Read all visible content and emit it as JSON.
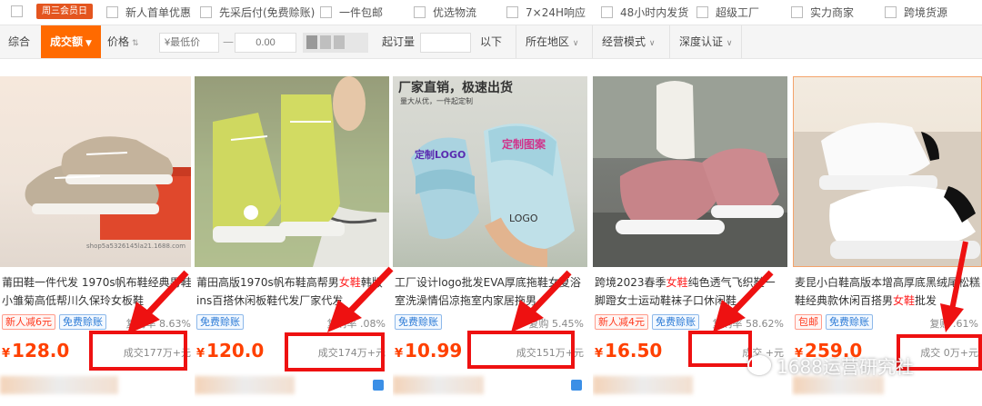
{
  "top_filters": {
    "wednesday_badge": "周三会员日",
    "items": [
      {
        "label": "新人首单优惠"
      },
      {
        "label": "先采后付(免费赊账)"
      },
      {
        "label": "一件包邮"
      },
      {
        "label": "优选物流"
      },
      {
        "label": "7×24H响应"
      },
      {
        "label": "48小时内发货"
      },
      {
        "label": "超级工厂"
      },
      {
        "label": "实力商家"
      },
      {
        "label": "跨境货源"
      }
    ]
  },
  "sortbar": {
    "comprehensive": "综合",
    "sales": "成交额",
    "price": "价格",
    "min_price_placeholder": "¥最低价",
    "dash": "—",
    "max_price_placeholder": "0.00",
    "moq_label": "起订量",
    "moq_suffix": "以下",
    "region": "所在地区",
    "business_mode": "经营模式",
    "certification": "深度认证"
  },
  "products": [
    {
      "title_a": "莆田鞋一件代发 1970s帆布鞋经典男鞋小雏菊高低帮川久保玲女板鞋",
      "title_hl": "",
      "title_b": "",
      "tags": [
        {
          "text": "新人减6元",
          "style": "red"
        },
        {
          "text": "免费赊账",
          "style": "blue"
        }
      ],
      "rebuy": "复购率 8.63%",
      "currency": "¥",
      "price": "128.0",
      "sold": "成交177万+元",
      "image_caption": "shop5a5326145la21.1688.com"
    },
    {
      "title_a": "莆田高版1970s帆布鞋高帮男",
      "title_hl": "女鞋",
      "title_b": "韩版ins百搭休闲板鞋代发厂家代发",
      "tags": [
        {
          "text": "免费赊账",
          "style": "blue"
        }
      ],
      "rebuy": "复购率 .08%",
      "currency": "¥",
      "price": "120.0",
      "sold": "成交174万+元",
      "image_caption": ""
    },
    {
      "title_a": "工厂设计logo批发EVA厚底拖鞋女夏浴室洗澡情侣凉拖室内家居拖男",
      "title_hl": "",
      "title_b": "",
      "tags": [
        {
          "text": "免费赊账",
          "style": "blue"
        }
      ],
      "rebuy": "复购 5.45%",
      "currency": "¥",
      "price": "10.99",
      "sold": "成交151万+元",
      "image_caption": "厂家直销，极速出货",
      "image_subcaption": "量大从优，一件起定制",
      "image_text1": "定制LOGO",
      "image_text2": "定制图案",
      "image_text3": "LOGO"
    },
    {
      "title_a": "跨境2023春季",
      "title_hl": "女鞋",
      "title_b": "纯色透气飞织鞋一脚蹬女士运动鞋袜子口休闲鞋",
      "tags": [
        {
          "text": "新人减4元",
          "style": "red"
        },
        {
          "text": "免费赊账",
          "style": "blue"
        }
      ],
      "rebuy": "复购率 58.62%",
      "currency": "¥",
      "price": "16.50",
      "sold": "成交 +元",
      "image_caption": ""
    },
    {
      "title_a": "麦昆小白鞋高版本增高厚底黑绒尾松糕鞋经典款休闲百搭男",
      "title_hl": "女鞋",
      "title_b": "批发",
      "tags": [
        {
          "text": "包邮",
          "style": "red"
        },
        {
          "text": "免费赊账",
          "style": "blue"
        }
      ],
      "rebuy": "复购 .61%",
      "currency": "¥",
      "price": "259.0",
      "sold": "成交 0万+元",
      "image_caption": ""
    }
  ],
  "watermark": "1688运营研究社",
  "colors": {
    "accent": "#ff6a00",
    "price": "#ff4000",
    "annotation": "#ee1111",
    "tag_blue": "#2b7ad6",
    "tag_red": "#ff3a1f"
  }
}
